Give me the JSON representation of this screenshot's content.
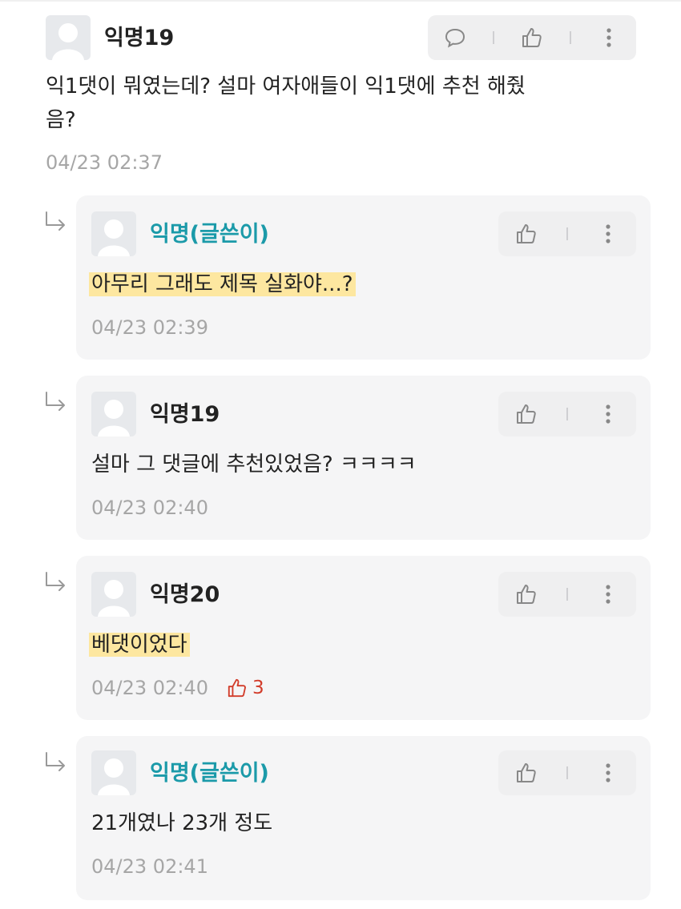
{
  "comments": [
    {
      "author": "익명19",
      "text_line1": "익1댓이 뭐였는데? 설마 여자애들이 익1댓에 추천 해줬",
      "text_line2": "음?",
      "time": "04/23 02:37"
    },
    {
      "author": "익명(글쓴이)",
      "text": "아무리 그래도 제목 실화야...?",
      "time": "04/23 02:39"
    },
    {
      "author": "익명19",
      "text": "설마 그 댓글에 추천있었음? ㅋㅋㅋㅋ",
      "time": "04/23 02:40"
    },
    {
      "author": "익명20",
      "text": "베댓이었다",
      "time": "04/23 02:40",
      "likes": "3"
    },
    {
      "author": "익명(글쓴이)",
      "text": "21개였나 23개 정도",
      "time": "04/23 02:41"
    }
  ],
  "icons": {
    "reply": "speech-bubble-icon",
    "like": "thumbs-up-icon",
    "more": "more-vertical-icon",
    "nested": "reply-arrow-icon"
  },
  "colors": {
    "author_label": "#1b9aa9",
    "highlight": "#fde7a0",
    "like_active": "#d23c2a",
    "card_bg": "#f5f5f6"
  }
}
